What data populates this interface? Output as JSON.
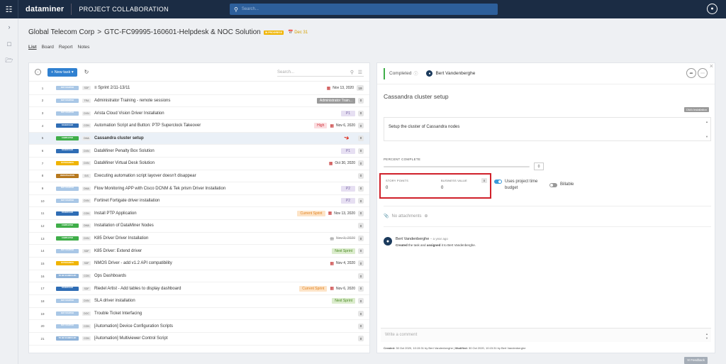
{
  "topbar": {
    "logo": "dataminer",
    "app_title": "PROJECT COLLABORATION",
    "search_placeholder": "Search..."
  },
  "header": {
    "breadcrumb_company": "Global Telecom Corp",
    "breadcrumb_sep": ">",
    "breadcrumb_project": "GTC-FC99995-160601-Helpdesk & NOC Solution",
    "project_status": "IN PROGRESS",
    "due_date": "Dec 31"
  },
  "tabs": [
    "List",
    "Board",
    "Report",
    "Notes"
  ],
  "list": {
    "new_task_label": "New task",
    "search_placeholder": "Search...",
    "rows": [
      {
        "num": "1",
        "status": "NOT STARTED",
        "code": "SDF",
        "title": "Sprint 2/11-13/11",
        "date": "Nov 13, 2020",
        "count": "19"
      },
      {
        "num": "2",
        "status": "NOT STARTED",
        "code": "TRA",
        "title": "Administrator Training - remote sessions",
        "tag": "Administrator Train...",
        "count": "0"
      },
      {
        "num": "3",
        "status": "NOT STARTED",
        "code": "DVN",
        "title": "Arista Cloud Vision Driver Installation",
        "tag": "P1",
        "count": "0"
      },
      {
        "num": "4",
        "status": "SCHEDULED",
        "code": "CON",
        "title": "Automation Script and Button: PTP Superclock Takeover",
        "tag": "High",
        "date": "Nov 6, 2020",
        "count": "0"
      },
      {
        "num": "5",
        "status": "COMPLETED",
        "code": "DMA",
        "title": "Cassandra cluster setup",
        "count": "0"
      },
      {
        "num": "6",
        "status": "SCHEDULED",
        "code": "DVN",
        "title": "DataMiner Penalty Box Solution",
        "tag": "P1",
        "count": "0"
      },
      {
        "num": "7",
        "status": "IN PROGRESS",
        "code": "DVN",
        "title": "DataMiner Virtual Desk Solution",
        "date": "Oct 30, 2020",
        "count": "0"
      },
      {
        "num": "8",
        "status": "INVESTIGATION",
        "code": "SIS",
        "title": "Executing automation script layover doesn't disappear",
        "count": "0"
      },
      {
        "num": "9",
        "status": "NOT STARTED",
        "code": "DMA",
        "title": "Flow Monitoring APP with Cisco DCNM & Tek prism Driver Installation",
        "tag": "P2",
        "count": "0"
      },
      {
        "num": "10",
        "status": "NOT STARTED",
        "code": "DVN",
        "title": "Fortinet Fortigate driver installation",
        "tag": "P2",
        "count": "0"
      },
      {
        "num": "11",
        "status": "SCHEDULED",
        "code": "CON",
        "title": "Install PTP Application",
        "tag": "Current Sprint",
        "date": "Nov 13, 2020",
        "count": "0"
      },
      {
        "num": "12",
        "status": "COMPLETED",
        "code": "DMA",
        "title": "Installation of DataMiner Nodes",
        "count": "0"
      },
      {
        "num": "13",
        "status": "COMPLETED",
        "code": "DVN",
        "title": "K85 Driver Driver Installation",
        "date": "Nov 3, 2020",
        "count": "0"
      },
      {
        "num": "14",
        "status": "NOT STARTED",
        "code": "SDF",
        "title": "K85 Driver: Extend driver",
        "tag": "Next Sprint",
        "count": "0"
      },
      {
        "num": "15",
        "status": "IN PROGRESS",
        "code": "SDF",
        "title": "NMOS Driver - add v1.2 API compatibility",
        "date": "Nov 4, 2020",
        "count": "0"
      },
      {
        "num": "16",
        "status": "TO BE SCHEDULED",
        "code": "CON",
        "title": "Ops Dashboards",
        "count": "0"
      },
      {
        "num": "17",
        "status": "SCHEDULED",
        "code": "SDF",
        "title": "Riedel Artist - Add tables to display dashboard",
        "tag": "Current Sprint",
        "date": "Nov 6, 2020",
        "count": "0"
      },
      {
        "num": "18",
        "status": "NOT STARTED",
        "code": "DVN",
        "title": "SLA driver installation",
        "tag": "Next Sprint",
        "count": "0"
      },
      {
        "num": "19",
        "status": "NOT STARTED",
        "code": "DOC",
        "title": "Trouble Ticket Interfacing",
        "count": "0"
      },
      {
        "num": "20",
        "status": "NOT STARTED",
        "code": "CON",
        "title": "[Automation] Device Configuration Scripts",
        "count": "0"
      },
      {
        "num": "21",
        "status": "TO BE SCHEDULED",
        "code": "CON",
        "title": "[Automation] Multiviewer Control Script",
        "count": "0"
      }
    ]
  },
  "detail": {
    "status": "Completed",
    "assignee": "Bert Vandenberghe",
    "title": "Cassandra cluster setup",
    "tag": "DMA Installation",
    "description": "Setup the cluster of Cassandra nodes",
    "percent_label": "PERCENT COMPLETE",
    "percent_value": "0",
    "story_points_label": "STORY POINTS",
    "story_points_value": "0",
    "business_value_label": "BUSINESS VALUE",
    "business_value_value": "0",
    "business_count": "0",
    "uses_time_label": "Uses project time budget",
    "billable_label": "Billable",
    "attachments_label": "No attachments",
    "activity_user": "Bert Vandenberghe",
    "activity_ago": "– a year ago",
    "activity_created": "Created",
    "activity_mid": "the task and",
    "activity_assigned": "assigned",
    "activity_end": "it to Bert Vandenberghe.",
    "comment_placeholder": "Write a comment",
    "meta_created_label": "Created:",
    "meta_created": "30 Oct 2020, 10:15:31 by Bert Vandenberghe |",
    "meta_modified_label": "Modified:",
    "meta_modified": "30 Oct 2020, 10:15:31 by Bert Vandenberghe"
  },
  "feedback_label": "Feedback",
  "colors": {
    "NOT STARTED": "#a9c7e6",
    "SCHEDULED": "#2f6db5",
    "COMPLETED": "#3fae49",
    "IN PROGRESS": "#f0b400",
    "INVESTIGATION": "#b7791f",
    "TO BE SCHEDULED": "#8fb3d9"
  }
}
